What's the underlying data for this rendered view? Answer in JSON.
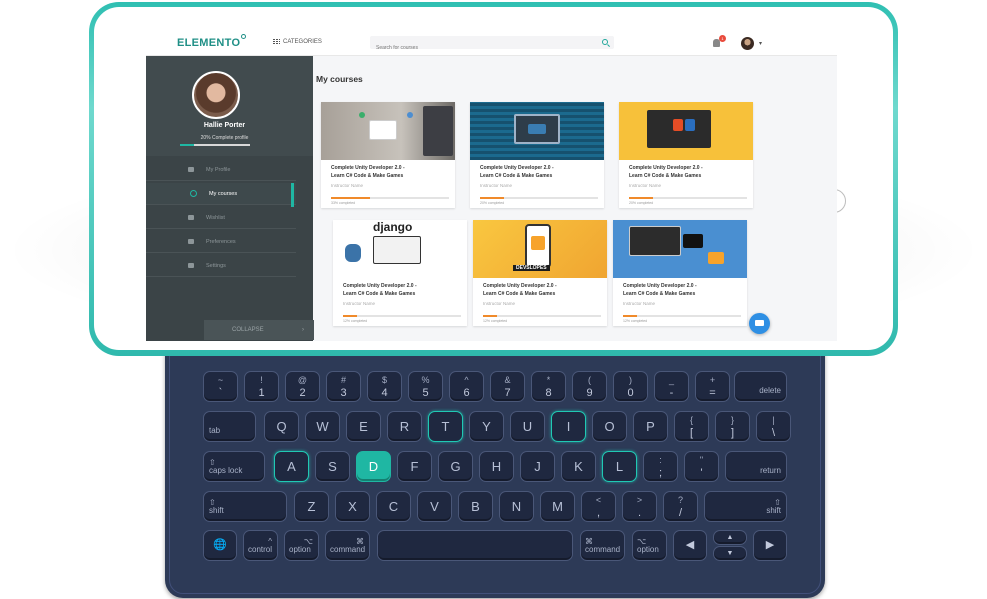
{
  "app": {
    "logo": "ELEMENTO"
  },
  "topbar": {
    "categories_label": "CATEGORIES",
    "search_placeholder": "Search for courses",
    "notification_count": "1"
  },
  "sidebar": {
    "user_name": "Hallie Porter",
    "profile_progress_label": "20% Complete profile",
    "profile_progress": 0.2,
    "items": [
      {
        "label": "My Profile",
        "icon": "user-icon"
      },
      {
        "label": "My courses",
        "icon": "play-circle-icon",
        "active": true
      },
      {
        "label": "Wishlist",
        "icon": "list-icon"
      },
      {
        "label": "Preferences",
        "icon": "sliders-icon"
      },
      {
        "label": "Settings",
        "icon": "gear-icon"
      }
    ],
    "collapse_label": "COLLAPSE"
  },
  "main": {
    "title": "My courses",
    "courses": [
      {
        "title1": "Complete Unity Developer 2.0 -",
        "title2": "Learn C# Code & Make Games",
        "instructor": "Instructor Name",
        "progress": 0.33,
        "progress_label": "33% completed"
      },
      {
        "title1": "Complete Unity Developer 2.0 -",
        "title2": "Learn C# Code & Make Games",
        "instructor": "Instructor Name",
        "progress": 0.2,
        "progress_label": "20% completed"
      },
      {
        "title1": "Complete Unity Developer 2.0 -",
        "title2": "Learn C# Code & Make Games",
        "instructor": "Instructor Name",
        "progress": 0.2,
        "progress_label": "20% completed"
      },
      {
        "title1": "Complete Unity Developer 2.0 -",
        "title2": "Learn C# Code & Make Games",
        "instructor": "Instructor Name",
        "progress": 0.12,
        "progress_label": "12% completed",
        "image_text": "django"
      },
      {
        "title1": "Complete Unity Developer 2.0 -",
        "title2": "Learn C# Code & Make Games",
        "instructor": "Instructor Name",
        "progress": 0.12,
        "progress_label": "12% completed",
        "image_text": "DEVSLOPES"
      },
      {
        "title1": "Complete Unity Developer 2.0 -",
        "title2": "Learn C# Code & Make Games",
        "instructor": "Instructor Name",
        "progress": 0.12,
        "progress_label": "12% completed"
      }
    ]
  },
  "keyboard": {
    "row1": [
      [
        "~",
        "`"
      ],
      [
        "!",
        "1"
      ],
      [
        "@",
        "2"
      ],
      [
        "#",
        "3"
      ],
      [
        "$",
        "4"
      ],
      [
        "%",
        "5"
      ],
      [
        "^",
        "6"
      ],
      [
        "&",
        "7"
      ],
      [
        "*",
        "8"
      ],
      [
        "(",
        "9"
      ],
      [
        ")",
        "0"
      ],
      [
        "_",
        "-"
      ],
      [
        "+",
        "="
      ]
    ],
    "delete": "delete",
    "tab": "tab",
    "row2": [
      "Q",
      "W",
      "E",
      "R",
      "T",
      "Y",
      "U",
      "I",
      "O",
      "P"
    ],
    "row2_sym": [
      [
        "{",
        "["
      ],
      [
        "}",
        "]"
      ],
      [
        "|",
        "\\"
      ]
    ],
    "caps": "caps lock",
    "row3": [
      "A",
      "S",
      "D",
      "F",
      "G",
      "H",
      "J",
      "K",
      "L"
    ],
    "row3_sym": [
      [
        ":",
        ";"
      ],
      [
        "\"",
        "'"
      ]
    ],
    "return": "return",
    "shift": "shift",
    "row4": [
      "Z",
      "X",
      "C",
      "V",
      "B",
      "N",
      "M"
    ],
    "row4_sym": [
      [
        "<",
        ","
      ],
      [
        ">",
        "."
      ],
      [
        "?",
        "/"
      ]
    ],
    "control": "control",
    "option": "option",
    "command": "command",
    "highlighted": [
      "T",
      "I",
      "A",
      "L"
    ],
    "pressed": [
      "D"
    ],
    "accent": "#1fb7a3"
  }
}
